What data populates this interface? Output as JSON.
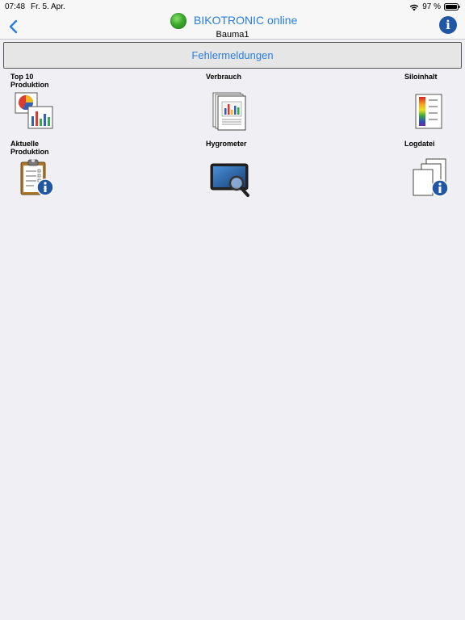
{
  "status_bar": {
    "time": "07:48",
    "date": "Fr. 5. Apr.",
    "battery": "97 %"
  },
  "nav": {
    "title": "BIKOTRONIC online",
    "subtitle": "Bauma1",
    "connection_color": "#3aa82a"
  },
  "error_button": {
    "label": "Fehlermeldungen"
  },
  "tiles": [
    {
      "label": "Top 10\nProduktion",
      "icon": "charts-icon"
    },
    {
      "label": "Verbrauch",
      "icon": "report-icon"
    },
    {
      "label": "Siloinhalt",
      "icon": "color-scale-icon"
    },
    {
      "label": "Aktuelle\nProduktion",
      "icon": "clipboard-info-icon"
    },
    {
      "label": "Hygrometer",
      "icon": "tablet-magnifier-icon"
    },
    {
      "label": "Logdatei",
      "icon": "documents-info-icon"
    }
  ],
  "colors": {
    "accent": "#2a7de1",
    "info": "#2156a5"
  }
}
